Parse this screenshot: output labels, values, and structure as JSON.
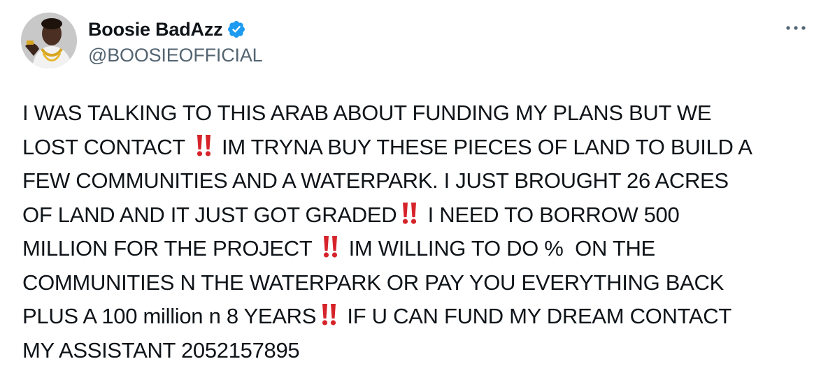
{
  "author": {
    "display_name": "Boosie BadAzz",
    "handle": "@BOOSIEOFFICIAL",
    "verified": true,
    "avatar_icon": "profile-photo"
  },
  "menu": {
    "icon": "more-horizontal-icon"
  },
  "tweet": {
    "lines": [
      [
        "I WAS TALKING TO THIS ARAB ABOUT FUNDING MY PLANS BUT WE"
      ],
      [
        "LOST CONTACT ",
        "!!",
        " IM TRYNA BUY THESE PIECES OF LAND TO BUILD A"
      ],
      [
        "FEW COMMUNITIES AND A WATERPARK. I JUST BROUGHT 26 ACRES"
      ],
      [
        "OF LAND AND IT JUST GOT GRADED",
        "!!",
        " I NEED TO BORROW 500"
      ],
      [
        "MILLION FOR THE PROJECT ",
        "!!",
        " IM WILLING TO DO %  ON THE"
      ],
      [
        "COMMUNITIES N THE WATERPARK OR PAY YOU EVERYTHING BACK"
      ],
      [
        "PLUS A 100 million n 8 YEARS",
        "!!",
        " IF U CAN FUND MY DREAM CONTACT"
      ],
      [
        "MY ASSISTANT 2052157895"
      ]
    ]
  },
  "colors": {
    "text": "#0f1419",
    "secondary": "#536471",
    "verified_blue": "#1d9bf0",
    "emoji_red": "#d6232a"
  }
}
